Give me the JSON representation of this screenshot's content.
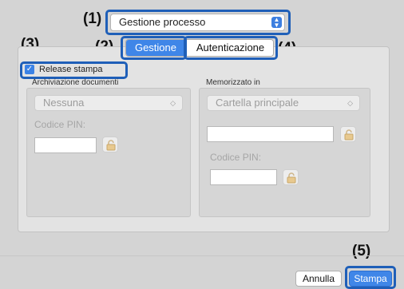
{
  "callouts": {
    "c1": "(1)",
    "c2": "(2)",
    "c3": "(3)",
    "c4": "(4)",
    "c5": "(5)"
  },
  "process_select": {
    "value": "Gestione processo"
  },
  "tabs": {
    "gestione": "Gestione",
    "autenticazione": "Autenticazione",
    "active": "Gestione"
  },
  "release": {
    "label": "Release stampa",
    "checked": true
  },
  "archive": {
    "title": "Archiviazione documenti",
    "select_value": "Nessuna",
    "pin_label": "Codice PIN:"
  },
  "store": {
    "title": "Memorizzato in",
    "select_value": "Cartella principale",
    "pin_label": "Codice PIN:"
  },
  "buttons": {
    "cancel": "Annulla",
    "print": "Stampa"
  },
  "colors": {
    "accent": "#3f86e8",
    "highlight": "#1f5fb8"
  }
}
